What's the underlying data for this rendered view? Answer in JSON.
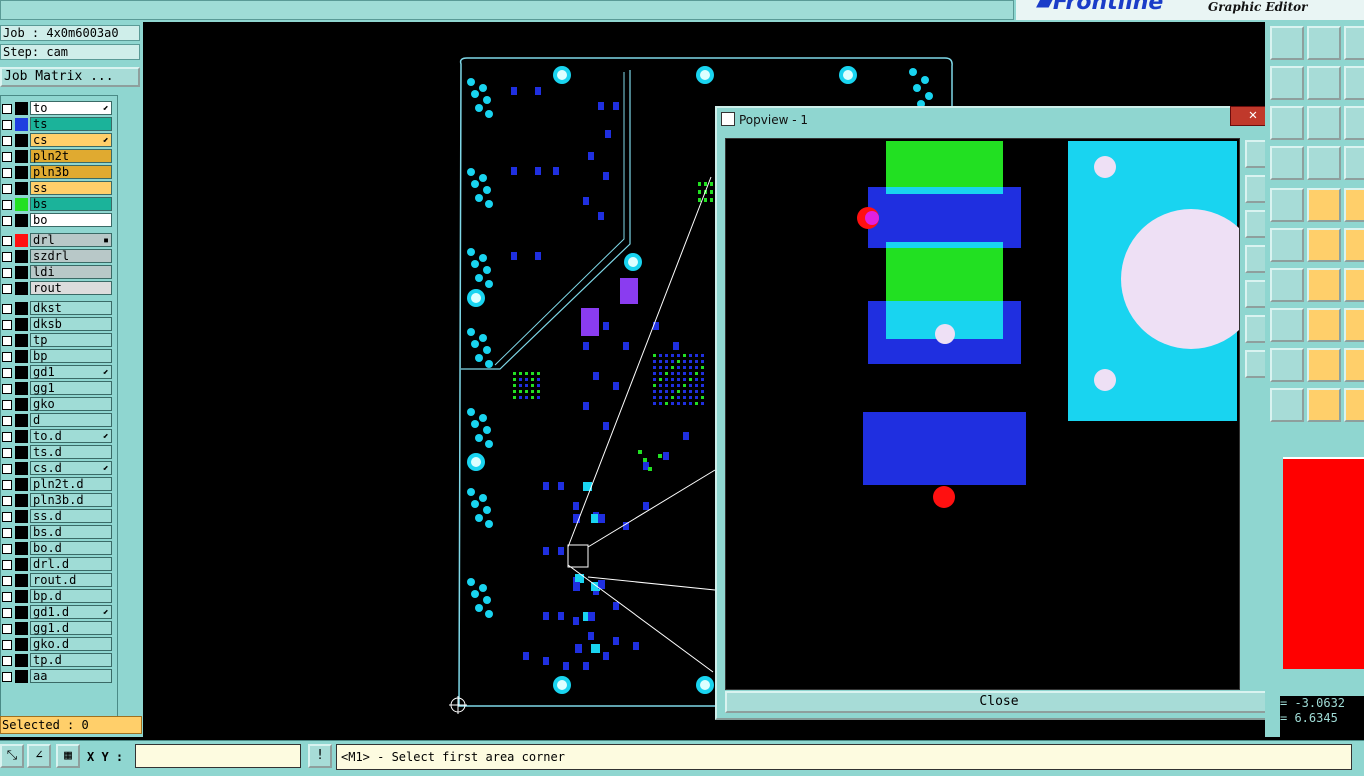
{
  "app": {
    "subtitle": "Graphic Editor"
  },
  "job": {
    "job_label": "Job : 4x0m6003a0",
    "step_label": "Step: cam",
    "matrix_button": "Job Matrix ..."
  },
  "layers": [
    {
      "name": "to",
      "fill": "#ffffff",
      "swatch": "#000000",
      "mark": "⬋"
    },
    {
      "name": "ts",
      "fill": "#1bb39a",
      "swatch": "#1f3fe0",
      "mark": ""
    },
    {
      "name": "cs",
      "fill": "#ffcf6a",
      "swatch": "#000000",
      "mark": "⬋"
    },
    {
      "name": "pln2t",
      "fill": "#e0aa30",
      "swatch": "#000000",
      "mark": ""
    },
    {
      "name": "pln3b",
      "fill": "#e0aa30",
      "swatch": "#000000",
      "mark": ""
    },
    {
      "name": "ss",
      "fill": "#ffcf6a",
      "swatch": "#000000",
      "mark": ""
    },
    {
      "name": "bs",
      "fill": "#1bb39a",
      "swatch": "#22e022",
      "mark": ""
    },
    {
      "name": "bo",
      "fill": "#ffffff",
      "swatch": "#000000",
      "mark": ""
    },
    {
      "name": "drl",
      "fill": "#b8c8c8",
      "swatch": "#ff1010",
      "mark": "▪"
    },
    {
      "name": "szdrl",
      "fill": "#b8c8c8",
      "swatch": "#000000",
      "mark": ""
    },
    {
      "name": "ldi",
      "fill": "#b8c8c8",
      "swatch": "#000000",
      "mark": ""
    },
    {
      "name": "rout",
      "fill": "#dcdcdc",
      "swatch": "#000000",
      "mark": ""
    },
    {
      "name": "dkst",
      "fill": "#9fdcd6",
      "swatch": "#000000",
      "mark": ""
    },
    {
      "name": "dksb",
      "fill": "#9fdcd6",
      "swatch": "#000000",
      "mark": ""
    },
    {
      "name": "tp",
      "fill": "#9fdcd6",
      "swatch": "#000000",
      "mark": ""
    },
    {
      "name": "bp",
      "fill": "#9fdcd6",
      "swatch": "#000000",
      "mark": ""
    },
    {
      "name": "gd1",
      "fill": "#9fdcd6",
      "swatch": "#000000",
      "mark": "⬋"
    },
    {
      "name": "gg1",
      "fill": "#9fdcd6",
      "swatch": "#000000",
      "mark": ""
    },
    {
      "name": "gko",
      "fill": "#9fdcd6",
      "swatch": "#000000",
      "mark": ""
    },
    {
      "name": "d",
      "fill": "#9fdcd6",
      "swatch": "#000000",
      "mark": ""
    },
    {
      "name": "to.d",
      "fill": "#9fdcd6",
      "swatch": "#000000",
      "mark": "⬋"
    },
    {
      "name": "ts.d",
      "fill": "#9fdcd6",
      "swatch": "#000000",
      "mark": ""
    },
    {
      "name": "cs.d",
      "fill": "#9fdcd6",
      "swatch": "#000000",
      "mark": "⬋"
    },
    {
      "name": "pln2t.d",
      "fill": "#9fdcd6",
      "swatch": "#000000",
      "mark": ""
    },
    {
      "name": "pln3b.d",
      "fill": "#9fdcd6",
      "swatch": "#000000",
      "mark": ""
    },
    {
      "name": "ss.d",
      "fill": "#9fdcd6",
      "swatch": "#000000",
      "mark": ""
    },
    {
      "name": "bs.d",
      "fill": "#9fdcd6",
      "swatch": "#000000",
      "mark": ""
    },
    {
      "name": "bo.d",
      "fill": "#9fdcd6",
      "swatch": "#000000",
      "mark": ""
    },
    {
      "name": "drl.d",
      "fill": "#9fdcd6",
      "swatch": "#000000",
      "mark": ""
    },
    {
      "name": "rout.d",
      "fill": "#9fdcd6",
      "swatch": "#000000",
      "mark": ""
    },
    {
      "name": "bp.d",
      "fill": "#9fdcd6",
      "swatch": "#000000",
      "mark": ""
    },
    {
      "name": "gd1.d",
      "fill": "#9fdcd6",
      "swatch": "#000000",
      "mark": "⬋"
    },
    {
      "name": "gg1.d",
      "fill": "#9fdcd6",
      "swatch": "#000000",
      "mark": ""
    },
    {
      "name": "gko.d",
      "fill": "#9fdcd6",
      "swatch": "#000000",
      "mark": ""
    },
    {
      "name": "tp.d",
      "fill": "#9fdcd6",
      "swatch": "#000000",
      "mark": ""
    },
    {
      "name": "aa",
      "fill": "#9fdcd6",
      "swatch": "#000000",
      "mark": ""
    }
  ],
  "status": {
    "selected": "Selected : 0",
    "xy_label": "X Y :",
    "xy_value": "",
    "prompt": "<M1> - Select first area corner",
    "coord_x": "= -3.0632",
    "coord_y": "= 6.6345"
  },
  "popview": {
    "title": "Popview - 1",
    "close_x": "✕",
    "close_button": "Close"
  },
  "colors": {
    "panel": "#8fd6d0",
    "board_outline": "#7fd8e8",
    "pad_cyan": "#19d4f0",
    "pad_blue": "#1f2fe0",
    "pad_green": "#22e022",
    "drill_red": "#ff1010"
  }
}
